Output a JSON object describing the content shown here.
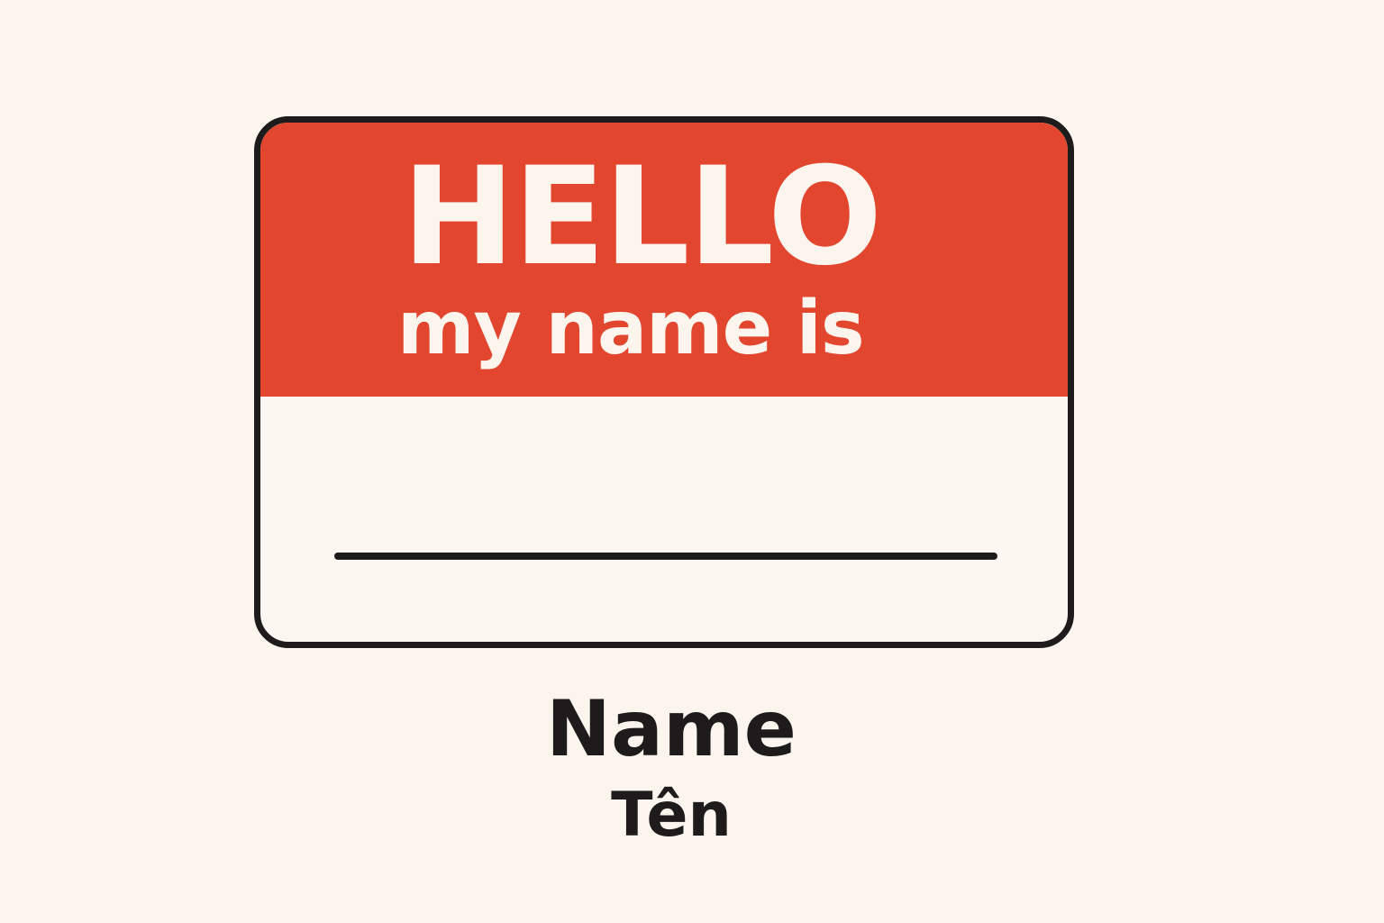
{
  "badge": {
    "title": "HELLO",
    "subtitle": "my name is"
  },
  "caption": {
    "primary": "Name",
    "secondary": "Tên"
  },
  "colors": {
    "background": "#fbf5ed",
    "header_red": "#e2462f",
    "border": "#1d1b1b",
    "header_text": "#fbf5ed",
    "caption_text": "#1d1b1b"
  }
}
